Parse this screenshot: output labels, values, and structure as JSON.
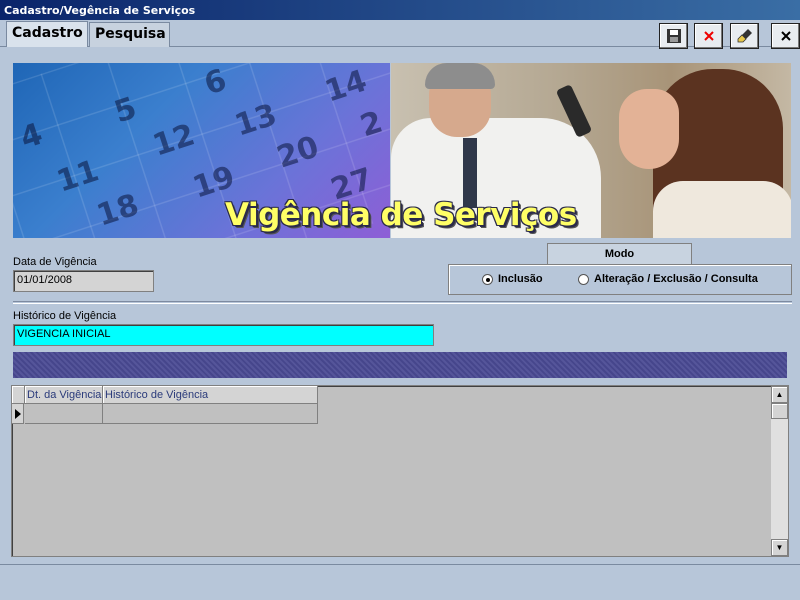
{
  "window": {
    "title": "Cadastro/Vegência de Serviços"
  },
  "tabs": [
    {
      "label": "Cadastro",
      "active": true
    },
    {
      "label": "Pesquisa",
      "active": false
    }
  ],
  "toolbar": {
    "buttons": [
      {
        "name": "save-button",
        "icon": "floppy-disk-icon"
      },
      {
        "name": "cancel-button",
        "icon": "red-x-icon"
      },
      {
        "name": "clear-button",
        "icon": "eraser-brush-icon"
      },
      {
        "name": "close-button",
        "icon": "close-icon"
      }
    ]
  },
  "banner": {
    "title": "Vigência de Serviços",
    "calendar_numbers": [
      "6",
      "5",
      "14",
      "4",
      "12",
      "13",
      "2",
      "11",
      "20",
      "18",
      "19",
      "27"
    ]
  },
  "form": {
    "date_label": "Data de Vigência",
    "date_value": "01/01/2008",
    "history_label": "Histórico de Vigência",
    "history_value": "VIGENCIA INICIAL"
  },
  "modo": {
    "label": "Modo",
    "options": [
      {
        "label": "Inclusão",
        "selected": true
      },
      {
        "label": "Alteração / Exclusão / Consulta",
        "selected": false
      }
    ]
  },
  "grid": {
    "columns": [
      "Dt. da Vigência",
      "Histórico de Vigência"
    ],
    "rows": [
      [
        "",
        ""
      ]
    ]
  },
  "colors": {
    "history_field_bg": "#00ffff",
    "banner_title": "#ffff66",
    "stripe": "#4b4b90",
    "titlebar": "#0a246a"
  }
}
